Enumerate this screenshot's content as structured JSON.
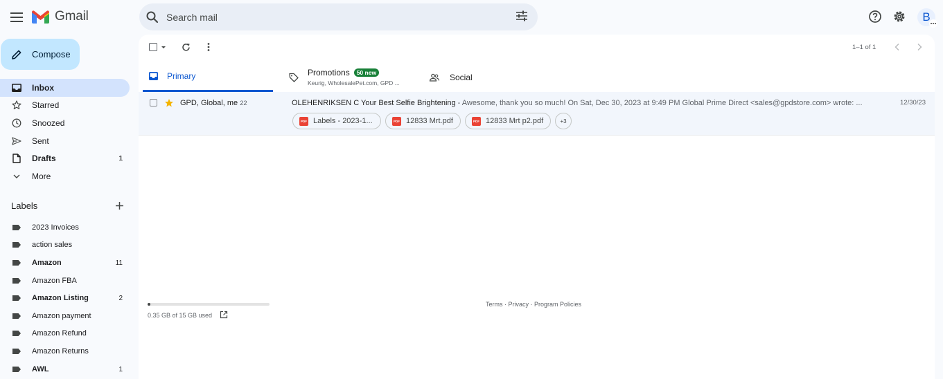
{
  "header": {
    "app_name": "Gmail",
    "search_placeholder": "Search mail",
    "avatar_letter": "B"
  },
  "compose_label": "Compose",
  "nav": [
    {
      "label": "Inbox",
      "count": "",
      "icon": "inbox-icon",
      "active": true
    },
    {
      "label": "Starred",
      "count": "",
      "icon": "star-icon"
    },
    {
      "label": "Snoozed",
      "count": "",
      "icon": "clock-icon"
    },
    {
      "label": "Sent",
      "count": "",
      "icon": "send-icon"
    },
    {
      "label": "Drafts",
      "count": "1",
      "icon": "draft-icon"
    },
    {
      "label": "More",
      "count": "",
      "icon": "chevron-down-icon"
    }
  ],
  "labels_heading": "Labels",
  "labels": [
    {
      "label": "2023 Invoices",
      "count": ""
    },
    {
      "label": "action sales",
      "count": ""
    },
    {
      "label": "Amazon",
      "count": "11"
    },
    {
      "label": "Amazon FBA",
      "count": ""
    },
    {
      "label": "Amazon Listing",
      "count": "2"
    },
    {
      "label": "Amazon payment",
      "count": ""
    },
    {
      "label": "Amazon Refund",
      "count": ""
    },
    {
      "label": "Amazon Returns",
      "count": ""
    },
    {
      "label": "AWL",
      "count": "1"
    }
  ],
  "toolbar": {
    "pager": "1–1 of 1"
  },
  "tabs": {
    "primary": "Primary",
    "promotions": "Promotions",
    "promotions_badge": "50 new",
    "promotions_senders": "Keurig, WholesalePet.com, GPD ...",
    "social": "Social"
  },
  "email": {
    "sender": "GPD, Global, me",
    "thread_count": "22",
    "subject": "OLEHENRIKSEN C Your Best Selfie Brightening",
    "snippet": " - Awesome, thank you so much! On Sat, Dec 30, 2023 at 9:49 PM Global Prime Direct <sales@gpdstore.com> wrote: ...",
    "date": "12/30/23",
    "attachments": [
      "Labels - 2023-1...",
      "12833 Mrt.pdf",
      "12833 Mrt p2.pdf"
    ],
    "more_attachments": "+3",
    "attachment_type_label": "PDF"
  },
  "footer": {
    "storage_text": "0.35 GB of 15 GB used",
    "storage_fraction": 0.023,
    "links": "Terms · Privacy · Program Policies"
  },
  "colors": {
    "compose_bg": "#c2e7ff",
    "active_nav_bg": "#d3e3fd",
    "primary_tab_accent": "#0b57d0",
    "promo_badge": "#188038",
    "star": "#f4b400"
  }
}
